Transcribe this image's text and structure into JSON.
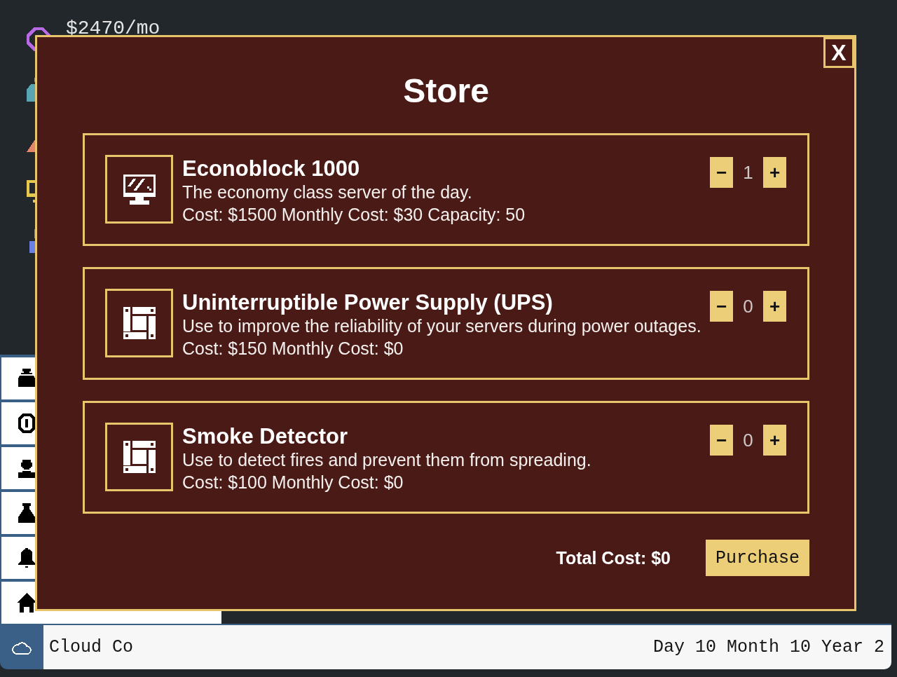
{
  "stat_text": "$2470/mo",
  "modal": {
    "title": "Store",
    "close_label": "X",
    "items": [
      {
        "kind": "server",
        "name": "Econoblock 1000",
        "description": "The economy class server of the day.",
        "details": "Cost: $1500 Monthly Cost: $30 Capacity: 50",
        "minus_label": "−",
        "quantity": "1",
        "plus_label": "+"
      },
      {
        "kind": "equipment",
        "name": "Uninterruptible Power Supply (UPS)",
        "description": "Use to improve the reliability of your servers during power outages.",
        "details": "Cost: $150 Monthly Cost: $0",
        "minus_label": "−",
        "quantity": "0",
        "plus_label": "+"
      },
      {
        "kind": "equipment",
        "name": "Smoke Detector",
        "description": "Use to detect fires and prevent them from spreading.",
        "details": "Cost: $100 Monthly Cost: $0",
        "minus_label": "−",
        "quantity": "0",
        "plus_label": "+"
      }
    ],
    "total": "Total Cost: $0",
    "purchase_label": "Purchase"
  },
  "status_bar": {
    "company": "Cloud Co",
    "date": "Day 10 Month 10 Year 2"
  }
}
